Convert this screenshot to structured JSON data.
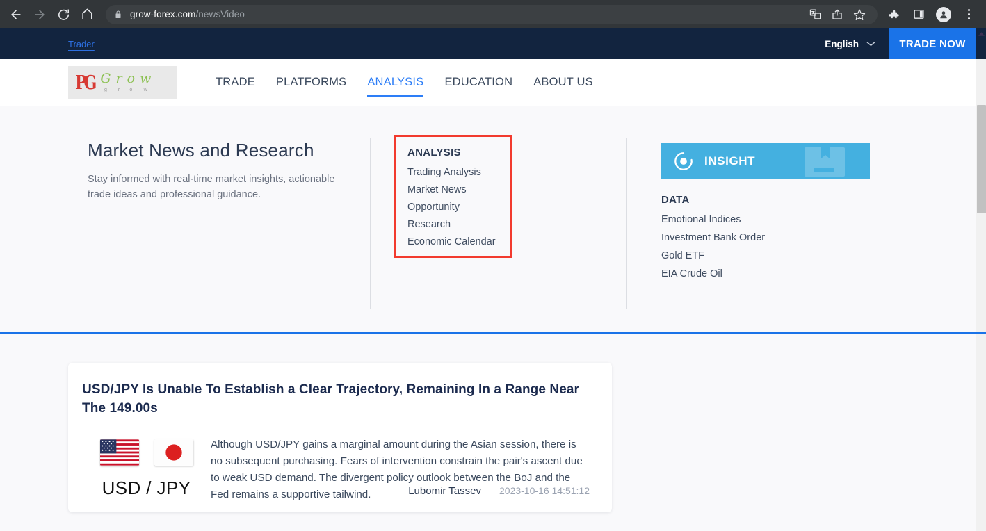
{
  "browser": {
    "url_domain": "grow-forex.com",
    "url_path": "/newsVideo",
    "icons": {
      "back": "back-arrow-icon",
      "forward": "forward-arrow-icon",
      "reload": "reload-icon",
      "home": "home-icon",
      "lock": "lock-icon",
      "translate": "translate-icon",
      "share": "share-icon",
      "bookmark": "star-icon",
      "extensions": "puzzle-icon",
      "side_panel": "side-panel-icon",
      "profile": "profile-avatar-icon",
      "menu": "three-dot-menu-icon"
    }
  },
  "topbar": {
    "trader_link": "Trader",
    "language": "English",
    "trade_now": "TRADE NOW"
  },
  "header": {
    "logo_mark": "PG",
    "logo_letters": [
      {
        "big": "G",
        "small": "g"
      },
      {
        "big": "r",
        "small": "r"
      },
      {
        "big": "o",
        "small": "o"
      },
      {
        "big": "w",
        "small": "w"
      }
    ],
    "nav": [
      {
        "label": "TRADE",
        "active": false
      },
      {
        "label": "PLATFORMS",
        "active": false
      },
      {
        "label": "ANALYSIS",
        "active": true
      },
      {
        "label": "EDUCATION",
        "active": false
      },
      {
        "label": "ABOUT US",
        "active": false
      }
    ]
  },
  "dropdown": {
    "intro_title": "Market News and Research",
    "intro_subtitle": "Stay informed with real-time market insights, actionable trade ideas and professional guidance.",
    "analysis_heading": "ANALYSIS",
    "analysis_items": [
      "Trading Analysis",
      "Market News",
      "Opportunity",
      "Research",
      "Economic Calendar"
    ],
    "insight_label": "INSIGHT",
    "data_heading": "DATA",
    "data_items": [
      "Emotional Indices",
      "Investment Bank Order",
      "Gold ETF",
      "EIA Crude Oil"
    ],
    "highlight_color": "#f23a2e",
    "insight_color": "#44b0e0"
  },
  "news": {
    "title": "USD/JPY Is Unable To Establish a Clear Trajectory, Remaining In a Range Near The 149.00s",
    "pair_label": "USD / JPY",
    "flags": [
      "us-flag-icon",
      "japan-flag-icon"
    ],
    "body": "Although USD/JPY gains a marginal amount during the Asian session, there is no subsequent purchasing. Fears of intervention constrain the pair's ascent due to weak USD demand. The divergent policy outlook between the BoJ and the Fed remains a supportive tailwind.",
    "author": "Lubomir Tassev",
    "timestamp": "2023-10-16 14:51:12"
  },
  "theme": {
    "accent_blue": "#1a73e8",
    "nav_blue": "#2d7ef7",
    "dark_navy": "#12243f",
    "page_bg": "#f9f9fb"
  }
}
